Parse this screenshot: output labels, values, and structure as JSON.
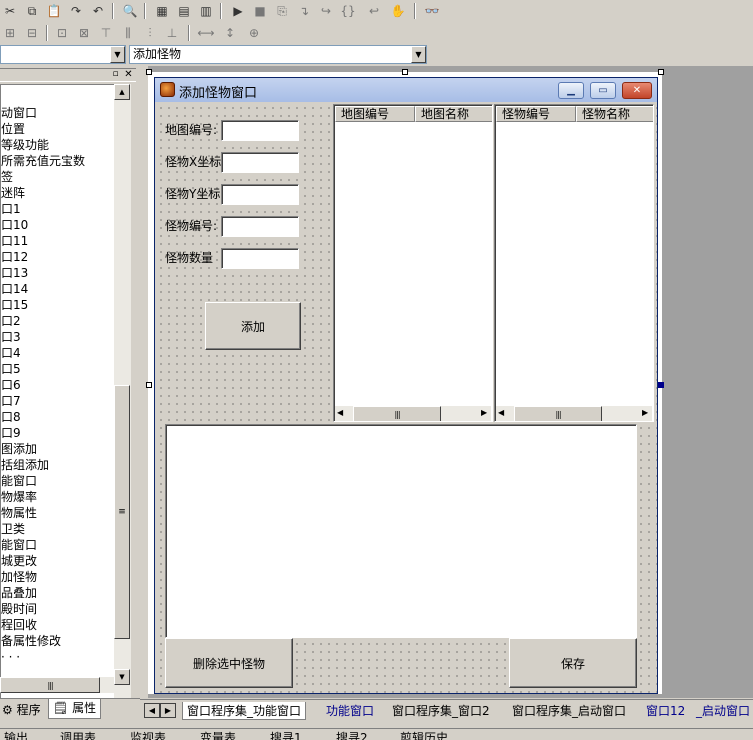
{
  "toolbar": {
    "combo_left_value": "",
    "combo_right_value": "添加怪物"
  },
  "tree": {
    "items": [
      "动窗口",
      "位置",
      "等级功能",
      "所需充值元宝数",
      "签",
      "迷阵",
      "口1",
      "口10",
      "口11",
      "口12",
      "口13",
      "口14",
      "口15",
      "口2",
      "口3",
      "口4",
      "口5",
      "口6",
      "口7",
      "口8",
      "口9",
      "图添加",
      "括组添加",
      "能窗口",
      "物爆率",
      "物属性",
      "卫类",
      "能窗口",
      "城更改",
      "加怪物",
      "品叠加",
      "殿时间",
      "程回收",
      "备属性修改",
      "· · ·"
    ]
  },
  "window": {
    "title": "添加怪物窗口",
    "labels": {
      "map_id": "地图编号:",
      "monster_x": "怪物X坐标",
      "monster_y": "怪物Y坐标",
      "monster_id": "怪物编号:",
      "monster_count": "怪物数量"
    },
    "add_button": "添加",
    "list1_headers": [
      "地图编号",
      "地图名称"
    ],
    "list2_headers": [
      "怪物编号",
      "怪物名称"
    ],
    "delete_button": "删除选中怪物",
    "save_button": "保存"
  },
  "left_tabs": {
    "program": "程序",
    "properties": "属性"
  },
  "bottom_tabs": [
    "窗口程序集_功能窗口",
    "功能窗口",
    "窗口程序集_窗口2",
    "窗口程序集_启动窗口",
    "窗口12",
    "_启动窗口"
  ],
  "output_bar": [
    "输出",
    "调用表",
    "监视表",
    "变量表",
    "搜寻1",
    "搜寻2",
    "剪辑历史"
  ]
}
